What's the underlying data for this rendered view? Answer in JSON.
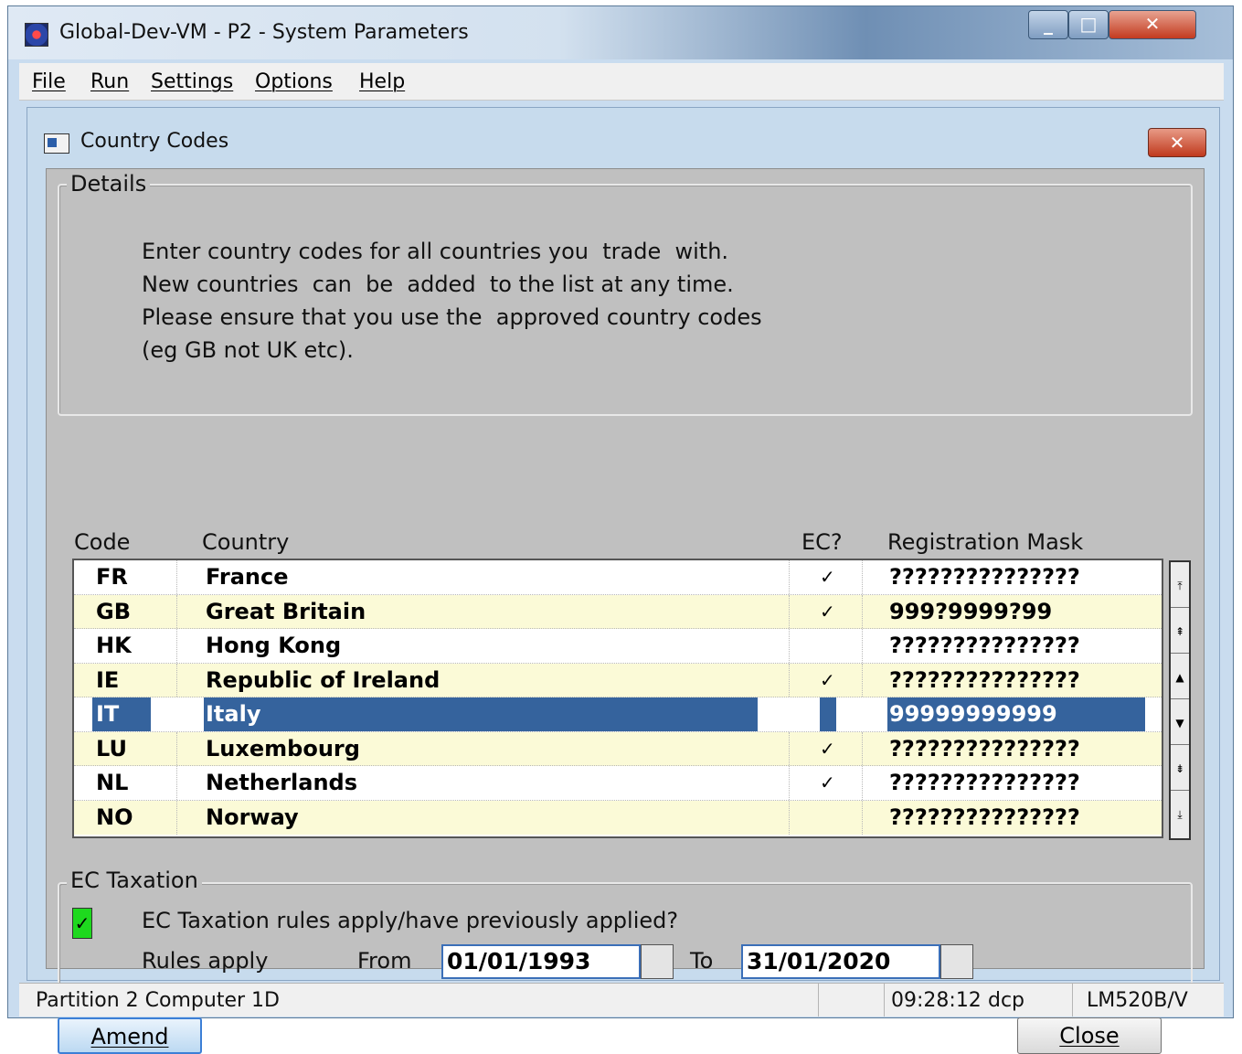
{
  "window": {
    "title": "Global-Dev-VM - P2 - System Parameters"
  },
  "menu": [
    "File",
    "Run",
    "Settings",
    "Options",
    "Help"
  ],
  "dialog": {
    "title": "Country Codes",
    "details_group": "Details",
    "details_lines": [
      "Enter country codes for all countries you  trade  with.",
      "New countries  can  be  added  to the list at any time.",
      "Please ensure that you use the  approved country codes",
      "(eg GB not UK etc)."
    ],
    "columns": {
      "code": "Code",
      "country": "Country",
      "ec": "EC?",
      "mask": "Registration Mask"
    },
    "rows": [
      {
        "code": "FR",
        "country": "France",
        "ec": "✓",
        "mask": "???????????????"
      },
      {
        "code": "GB",
        "country": "Great Britain",
        "ec": "✓",
        "mask": "999?9999?99"
      },
      {
        "code": "HK",
        "country": "Hong Kong",
        "ec": "",
        "mask": "???????????????"
      },
      {
        "code": "IE",
        "country": "Republic of Ireland",
        "ec": "✓",
        "mask": "???????????????"
      },
      {
        "code": "IT",
        "country": "Italy",
        "ec": "",
        "mask": "99999999999"
      },
      {
        "code": "LU",
        "country": "Luxembourg",
        "ec": "✓",
        "mask": "???????????????"
      },
      {
        "code": "NL",
        "country": "Netherlands",
        "ec": "✓",
        "mask": "???????????????"
      },
      {
        "code": "NO",
        "country": "Norway",
        "ec": "",
        "mask": "???????????????"
      }
    ],
    "selected_row": "IT",
    "ec_group": "EC Taxation",
    "ec_check_label": "EC Taxation rules apply/have previously applied?",
    "ec_checked": "✓",
    "rules_label": "Rules apply",
    "from_label": "From",
    "from_value": "01/01/1993",
    "to_label": "To",
    "to_value": "31/01/2020",
    "amend_button": "Amend",
    "close_button": "Close"
  },
  "status": {
    "left": "Partition 2 Computer 1D",
    "time": "09:28:12",
    "user": "dcp",
    "code": "LM520B/V"
  },
  "colors": {
    "selection": "#35639d",
    "alt_row": "#fbfad7",
    "checkbox_on": "#1ed91e"
  }
}
